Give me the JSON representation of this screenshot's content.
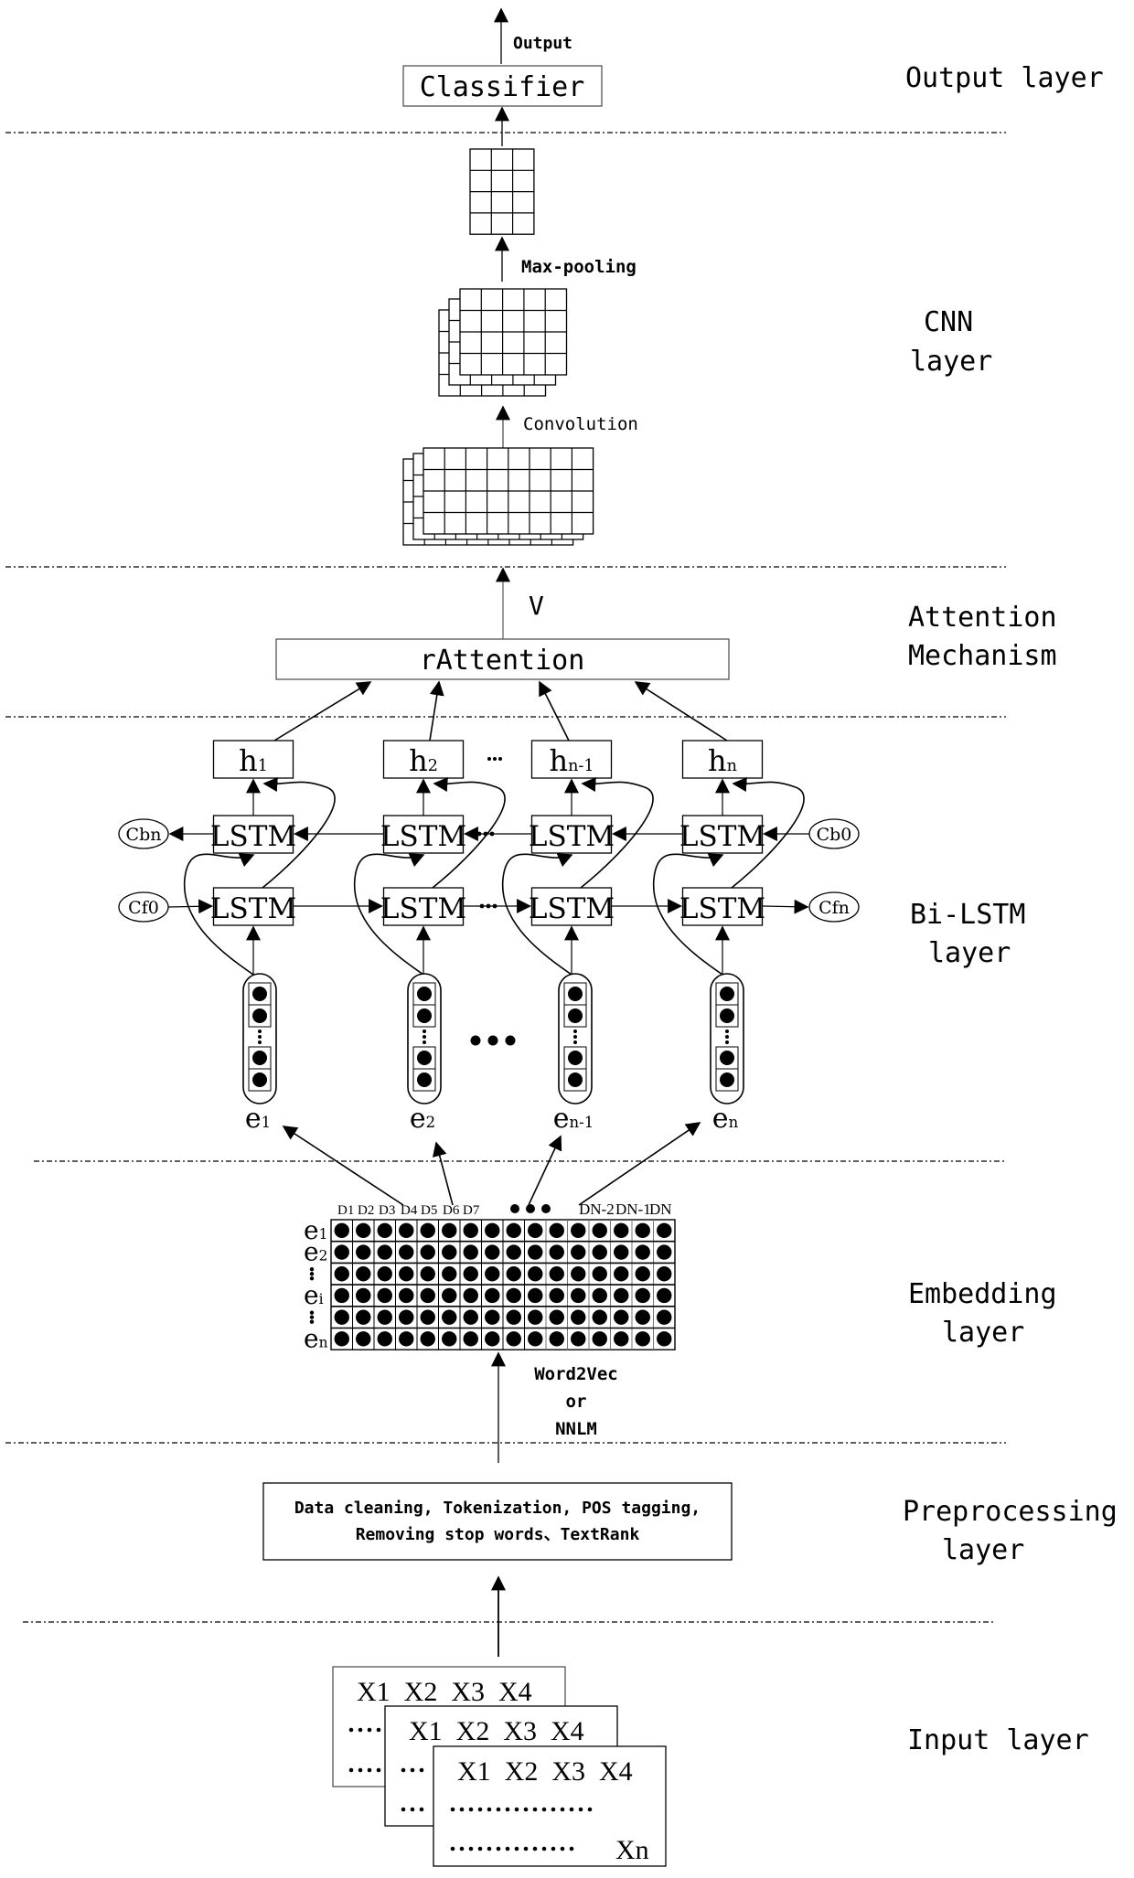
{
  "layers": {
    "output": "Output layer",
    "cnn": [
      "CNN",
      "layer"
    ],
    "attention": [
      "Attention",
      "Mechanism"
    ],
    "bilstm": [
      "Bi-LSTM",
      "layer"
    ],
    "embedding": [
      "Embedding",
      "layer"
    ],
    "preprocessing": [
      "Preprocessing",
      "layer"
    ],
    "input": "Input layer"
  },
  "output_block": {
    "output_label": "Output",
    "classifier_label": "Classifier",
    "maxpool_label": "Max-pooling",
    "conv_label": "Convolution"
  },
  "attention_block": {
    "box_label": "rAttention",
    "v_label": "V"
  },
  "bilstm_block": {
    "hidden": [
      {
        "base": "h",
        "sub": "1"
      },
      {
        "base": "h",
        "sub": "2"
      },
      {
        "base": "h",
        "sub": "n-1"
      },
      {
        "base": "h",
        "sub": "n"
      }
    ],
    "hidden_ellipsis": "···",
    "lstm_label": "LSTM",
    "cells": {
      "cbn": "Cbn",
      "cf0": "Cf0",
      "cb0": "Cb0",
      "cfn": "Cfn"
    },
    "embeddings": [
      {
        "base": "e",
        "sub": "1"
      },
      {
        "base": "e",
        "sub": "2"
      },
      {
        "base": "e",
        "sub": "n-1"
      },
      {
        "base": "e",
        "sub": "n"
      }
    ]
  },
  "embedding_block": {
    "col_labels_left": [
      "D1",
      "D2",
      "D3",
      "D4",
      "D5",
      "D6",
      "D7"
    ],
    "col_labels_right": [
      "DN-2",
      "DN-1",
      "DN"
    ],
    "row_labels": [
      {
        "base": "e",
        "sub": "1"
      },
      {
        "base": "e",
        "sub": "2"
      },
      {
        "base": "⋮",
        "sub": ""
      },
      {
        "base": "e",
        "sub": "i"
      },
      {
        "base": "⋮",
        "sub": ""
      },
      {
        "base": "e",
        "sub": "n"
      }
    ],
    "method_lines": [
      "Word2Vec",
      "or",
      "NNLM"
    ]
  },
  "preprocessing_block": {
    "lines": [
      "Data cleaning, Tokenization, POS tagging,",
      "Removing stop words、TextRank"
    ]
  },
  "input_block": {
    "doc_header": "X1  X2  X3  X4",
    "last_token": "Xn"
  }
}
